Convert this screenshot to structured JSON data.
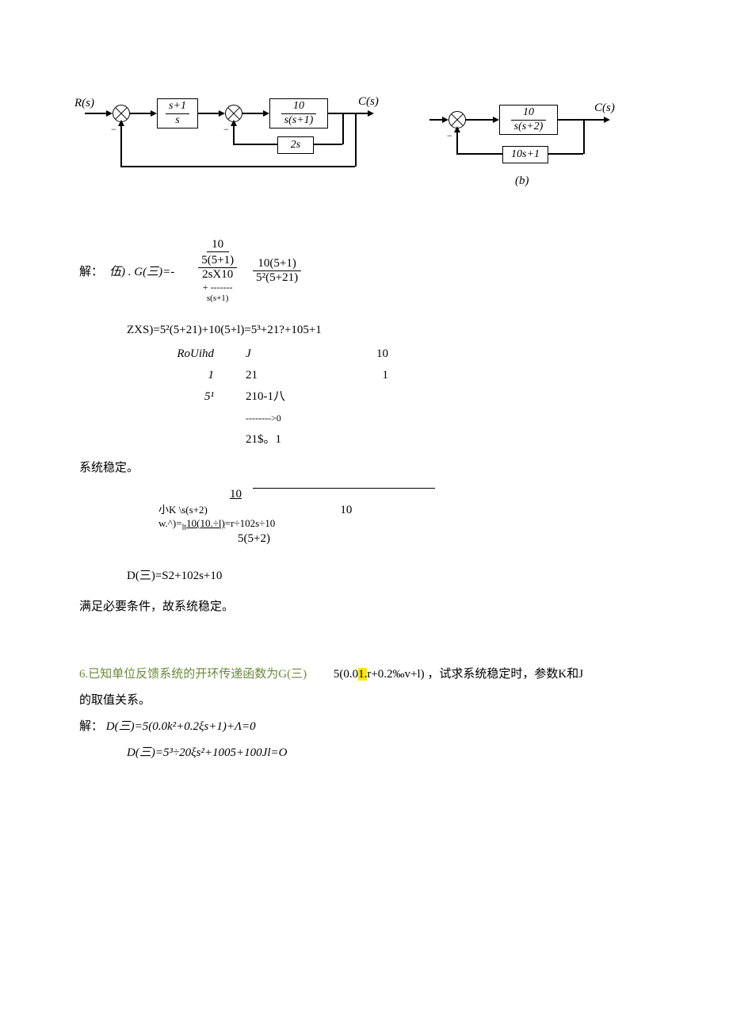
{
  "diagram_a": {
    "r_s": "R(s)",
    "c_s": "C(s)",
    "block1_num": "s+1",
    "block1_den": "s",
    "block2_num": "10",
    "block2_den": "s(s+1)",
    "block3": "2s"
  },
  "diagram_b": {
    "c_s": "C(s)",
    "block1_num": "10",
    "block1_den": "s(s+2)",
    "block2": "10s+1",
    "caption": "(b)"
  },
  "solution_a": {
    "prefix": "解：",
    "line1_a": "伍) . G(三)=-",
    "f1_top": "10",
    "f1_num": "5(5+1)",
    "f1_den": "2sX10",
    "f1_plus": "+  -------",
    "f1_extra": "s(s+1)",
    "f2_num": "10(5+1)",
    "f2_den": "5²(5+21)",
    "dxs": "ZXS)=5²(5+21)+10(5+l)=5³+21?+105+1",
    "routh_title": "RoUihd",
    "routh": {
      "r1": {
        "c1": "",
        "c2": "J",
        "c3": "10"
      },
      "r2": {
        "c1": "1",
        "c2": "21",
        "c3": "1"
      },
      "r3": {
        "c1": "5¹",
        "c2": "210-1八",
        "arrow": "-------->0",
        "c3": ""
      },
      "r4": {
        "c1": "",
        "c2": "21$。1",
        "c3": ""
      }
    },
    "stable": "系统稳定。"
  },
  "solution_b": {
    "line_top_num": "10",
    "line2a": "小K \\s(s+2)",
    "line2b_prefix": "w.^)=",
    "line2b_sub": "lt",
    "line2b_under": "10(10.÷l)",
    "line2b_rest": "=r÷102s÷10",
    "line2_right": "10",
    "line3": "5(5+2)",
    "d_s": "D(三)=S2+102s+10",
    "stable": "满足必要条件，故系统稳定。"
  },
  "problem6": {
    "title": "6.已知单位反馈系统的开环传递函数为G(三)",
    "frac": "5(0.0",
    "hl": "1.",
    "frac2": "r+0.2‰v+l)",
    "tail": "，试求系统稳定时，参数K和J",
    "line2": "的取值关系。",
    "sol_prefix": "解：",
    "sol1": "D(三)=5(0.0k²+0.2ξs+1)+Λ=0",
    "sol2": "D(三)=5³÷20ξs²+1005+100Jl=O"
  }
}
